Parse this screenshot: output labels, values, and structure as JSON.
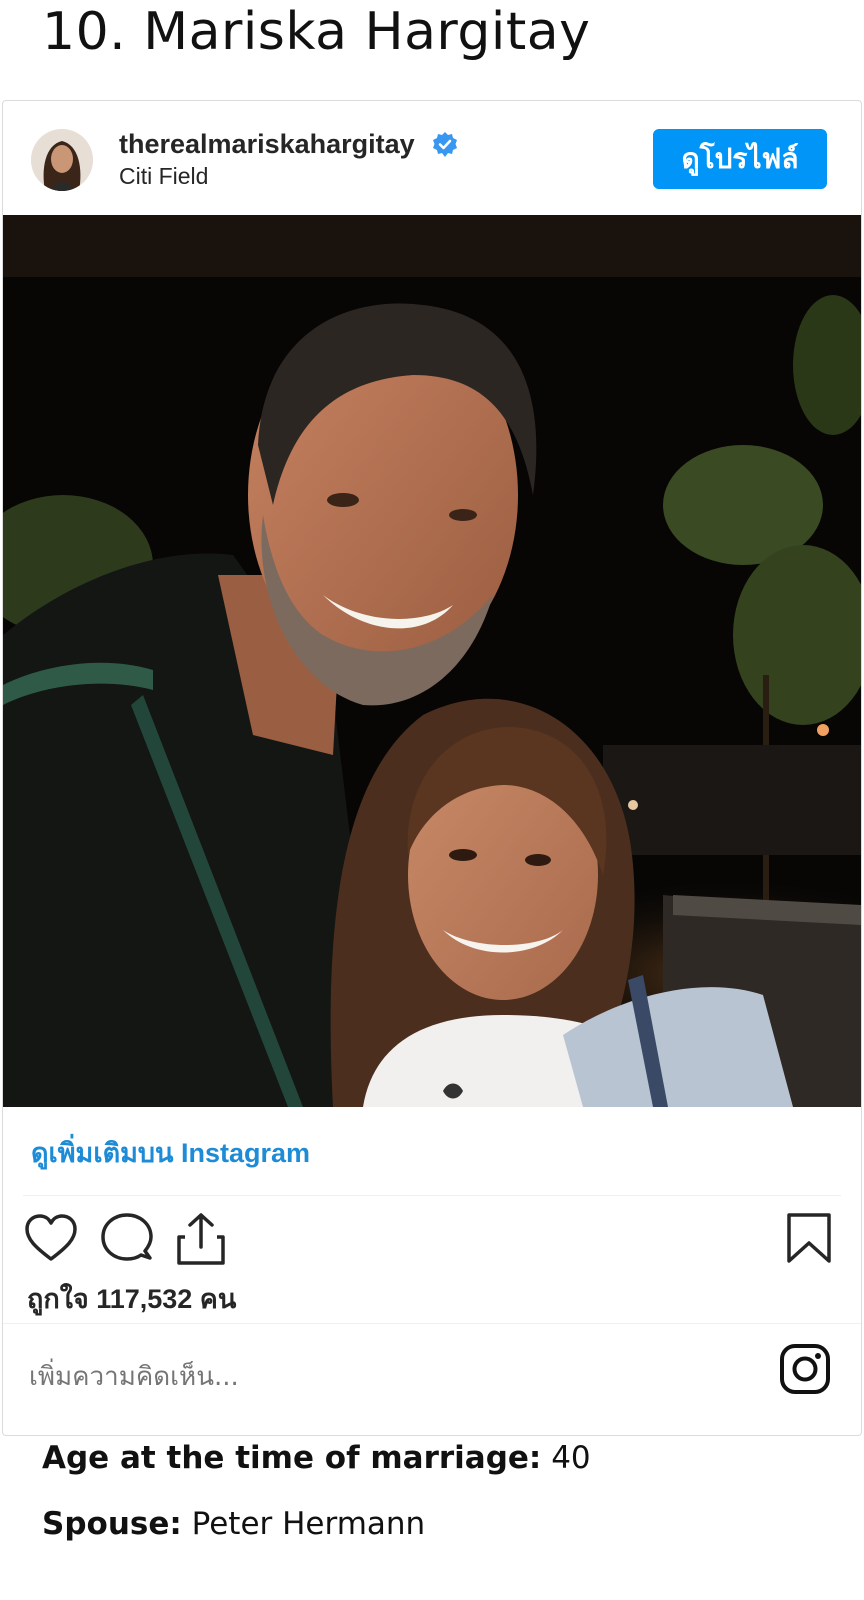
{
  "heading": "10. Mariska Hargitay",
  "post": {
    "username": "therealmariskahargitay",
    "location": "Citi Field",
    "view_profile_label": "ดูโปรไฟล์",
    "more_on_instagram": "ดูเพิ่มเติมบน Instagram",
    "likes_text": "ถูกใจ 117,532 คน",
    "comment_placeholder": "เพิ่มความคิดเห็น...",
    "icons": [
      "verified-badge-icon",
      "heart-icon",
      "comment-icon",
      "share-icon",
      "bookmark-icon",
      "instagram-icon"
    ]
  },
  "details": {
    "age_label": "Age at the time of marriage:",
    "age_value": "40",
    "spouse_label": "Spouse:",
    "spouse_value": "Peter Hermann"
  },
  "colors": {
    "accent": "#0095f6",
    "link": "#1d8bd6"
  }
}
